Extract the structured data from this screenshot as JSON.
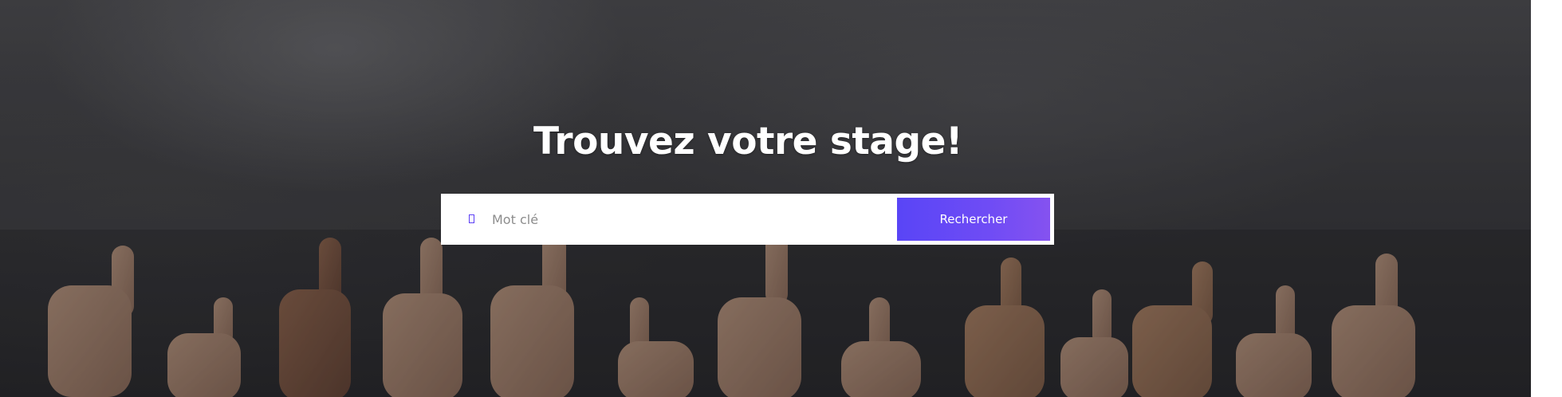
{
  "hero": {
    "title": "Trouvez votre stage!",
    "background_image": "thumbs-up-crowd"
  },
  "search": {
    "icon": "search-icon",
    "placeholder": "Mot clé",
    "value": "",
    "button_label": "Rechercher",
    "accent_color": "#5b48f6"
  }
}
